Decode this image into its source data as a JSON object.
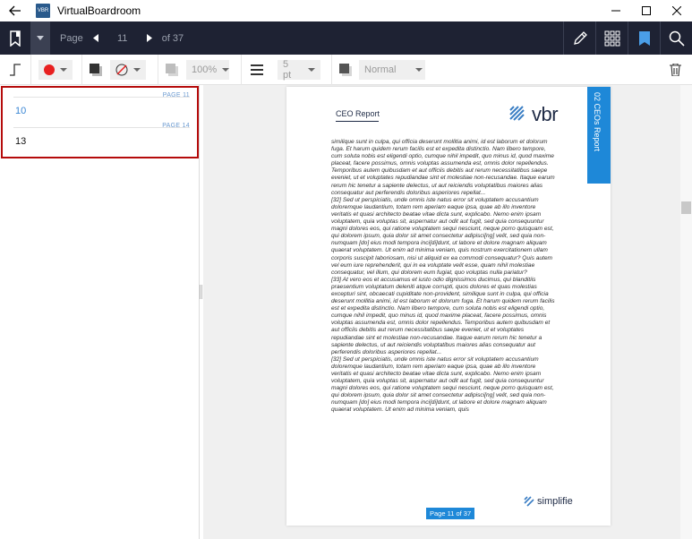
{
  "window": {
    "title": "VirtualBoardroom",
    "logo_text": "VBR",
    "icons": [
      "back-arrow-icon",
      "minimize-icon",
      "maximize-icon",
      "close-icon"
    ]
  },
  "toolbar": {
    "page_label": "Page",
    "current_page": "11",
    "of_total": "of 37",
    "icons": [
      "bookmark-add-icon",
      "chevron-down-icon",
      "prev-page-icon",
      "next-page-icon",
      "pen-icon",
      "grid-icon",
      "bookmark-icon",
      "search-icon"
    ],
    "colors": {
      "background": "#1e2233",
      "icon": "#ffffff"
    }
  },
  "annotation_bar": {
    "color_value": "#e82020",
    "fill_value": "none",
    "opacity": "100%",
    "line_width": "5 pt",
    "blend_mode": "Normal",
    "icons": [
      "line-tool-icon",
      "stroke-color-icon",
      "fill-color-icon",
      "opacity-icon",
      "line-width-icon",
      "blend-mode-icon",
      "trash-icon"
    ]
  },
  "bookmarks": [
    {
      "page_label": "PAGE 11",
      "value": "10",
      "active": true
    },
    {
      "page_label": "PAGE 14",
      "value": "13",
      "active": false
    }
  ],
  "document": {
    "header": "CEO Report",
    "logo_text": "vbr",
    "side_tab": "02 CEOs Report",
    "footer_logo": "simplifie",
    "page_badge": "Page 11 of 37",
    "body_text": "similique sunt in culpa, qui officia deserunt mollitia animi, id est laborum et dolorum fuga. Et harum quidem rerum facilis est et expedita distinctio. Nam libero tempore, cum soluta nobis est eligendi optio, cumque nihil impedit, quo minus id, quod maxime placeat, facere possimus, omnis voluptas assumenda est, omnis dolor repellendus. Temporibus autem quibusdam et aut officiis debitis aut rerum necessitatibus saepe eveniet, ut et voluptates repudiandae sint et molestiae non-recusandae. Itaque earum rerum hic tenetur a sapiente delectus, ut aut reiciendis voluptatibus maiores alias consequatur aut perferendis doloribus asperiores repellat...\n[32] Sed ut perspiciatis, unde omnis iste natus error sit voluptatem accusantium doloremque laudantium, totam rem aperiam eaque ipsa, quae ab illo inventore veritatis et quasi architecto beatae vitae dicta sunt, explicabo. Nemo enim ipsam voluptatem, quia voluptas sit, aspernatur aut odit aut fugit, sed quia consequuntur magni dolores eos, qui ratione voluptatem sequi nesciunt, neque porro quisquam est, qui dolorem ipsum, quia dolor sit amet consectetur adipisci[ng] velit, sed quia non-numquam [do] eius modi tempora inci[di]dunt, ut labore et dolore magnam aliquam quaerat voluptatem. Ut enim ad minima veniam, quis nostrum exercitationem ullam corporis suscipit laboriosam, nisi ut aliquid ex ea commodi consequatur? Quis autem vel eum iure reprehenderit, qui in ea voluptate velit esse, quam nihil molestiae consequatur, vel illum, qui dolorem eum fugiat, quo voluptas nulla pariatur?\n[33] At vero eos et accusamus et iusto odio dignissimos ducimus, qui blanditiis praesentium voluptatum deleniti atque corrupti, quos dolores et quas molestias excepturi sint, obcaecati cupiditate non-provident, similique sunt in culpa, qui officia deserunt mollitia animi, id est laborum et dolorum fuga. Et harum quidem rerum facilis est et expedita distinctio. Nam libero tempore, cum soluta nobis est eligendi optio, cumque nihil impedit, quo minus id, quod maxime placeat, facere possimus, omnis voluptas assumenda est, omnis dolor repellendus. Temporibus autem quibusdam et aut officiis debitis aut rerum necessitatibus saepe eveniet, ut et voluptates repudiandae sint et molestiae non-recusandae. Itaque earum rerum hic tenetur a sapiente delectus, ut aut reiciendis voluptatibus maiores alias consequatur aut perferendis doloribus asperiores repellat...\n[32] Sed ut perspiciatis, unde omnis iste natus error sit voluptatem accusantium doloremque laudantium, totam rem aperiam eaque ipsa, quae ab illo inventore veritatis et quasi architecto beatae vitae dicta sunt, explicabo. Nemo enim ipsam voluptatem, quia voluptas sit, aspernatur aut odit aut fugit, sed quia consequuntur magni dolores eos, qui ratione voluptatem sequi nesciunt, neque porro quisquam est, qui dolorem ipsum, quia dolor sit amet consectetur adipisci[ng] velit, sed quia non-numquam [do] eius modi tempora inci[di]dunt, ut labore et dolore magnam aliquam quaerat voluptatem. Ut enim ad minima veniam, quis"
  },
  "colors": {
    "accent_blue": "#1e88d8",
    "bookmark_border": "#b50b0b",
    "bookmark_link": "#3a86d4"
  }
}
